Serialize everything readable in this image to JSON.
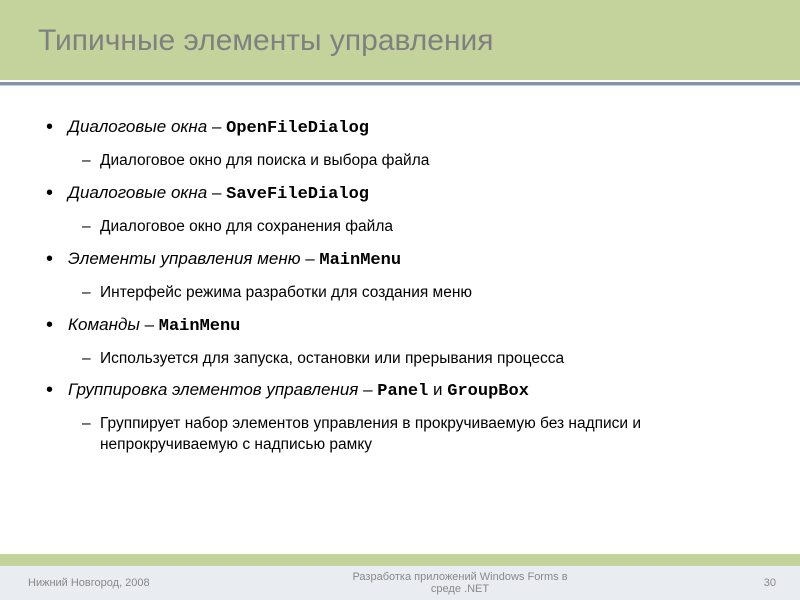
{
  "title": "Типичные элементы управления",
  "items": [
    {
      "label": "Диалоговые окна",
      "code": "OpenFileDialog",
      "sub": [
        "Диалоговое окно для поиска и выбора файла"
      ]
    },
    {
      "label": "Диалоговые окна",
      "code": "SaveFileDialog",
      "sub": [
        "Диалоговое  окно для сохранения файла"
      ]
    },
    {
      "label": "Элементы управления меню",
      "code": "MainMenu",
      "sub": [
        "Интерфейс режима разработки для создания меню"
      ]
    },
    {
      "label": "Команды",
      "code": "MainMenu",
      "sub": [
        "Используется для запуска, остановки или прерывания процесса"
      ]
    },
    {
      "label": "Группировка элементов управления",
      "codes": [
        "Panel",
        "GroupBox"
      ],
      "sub": [
        "Группирует набор элементов управления в прокручиваемую без надписи и непрокручиваемую с надписью рамку"
      ]
    }
  ],
  "footer": {
    "left": "Нижний Новгород, 2008",
    "center_line1": "Разработка приложений Windows Forms в",
    "center_line2": "среде .NET",
    "page": "30"
  }
}
